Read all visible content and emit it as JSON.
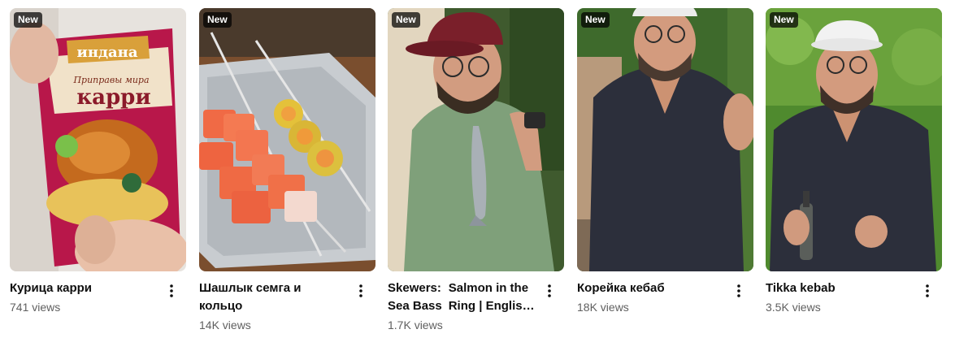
{
  "shorts": [
    {
      "badge": "New",
      "title": "Курица карри",
      "views": "741 views",
      "package_brand": "индана",
      "package_line": "Приправы мира",
      "package_product": "карри"
    },
    {
      "badge": "New",
      "title_line1": "Шашлык семга и",
      "title_line2": "кольцо",
      "views": "14K views"
    },
    {
      "badge": "New",
      "title_col1_line1": "Skewers:",
      "title_col1_line2": "Sea Bass",
      "title_col2_line1": "Salmon in the",
      "title_col2_line2": "Ring | Englis…",
      "views": "1.7K views"
    },
    {
      "badge": "New",
      "title": "Корейка кебаб",
      "views": "18K views"
    },
    {
      "badge": "New",
      "title": "Tikka kebab",
      "views": "3.5K views"
    }
  ],
  "icons": {
    "menu": "more-vert-icon"
  },
  "colors": {
    "badge_bg": "#000000",
    "title_text": "#0f0f0f",
    "meta_text": "#606060",
    "curry_pack": "#b8174a",
    "salmon": "#f06a45",
    "tray": "#c8ccd0",
    "shirt_green": "#7fa07a",
    "shirt_navy": "#2c2f3b",
    "cap_maroon": "#7a1f2a"
  }
}
